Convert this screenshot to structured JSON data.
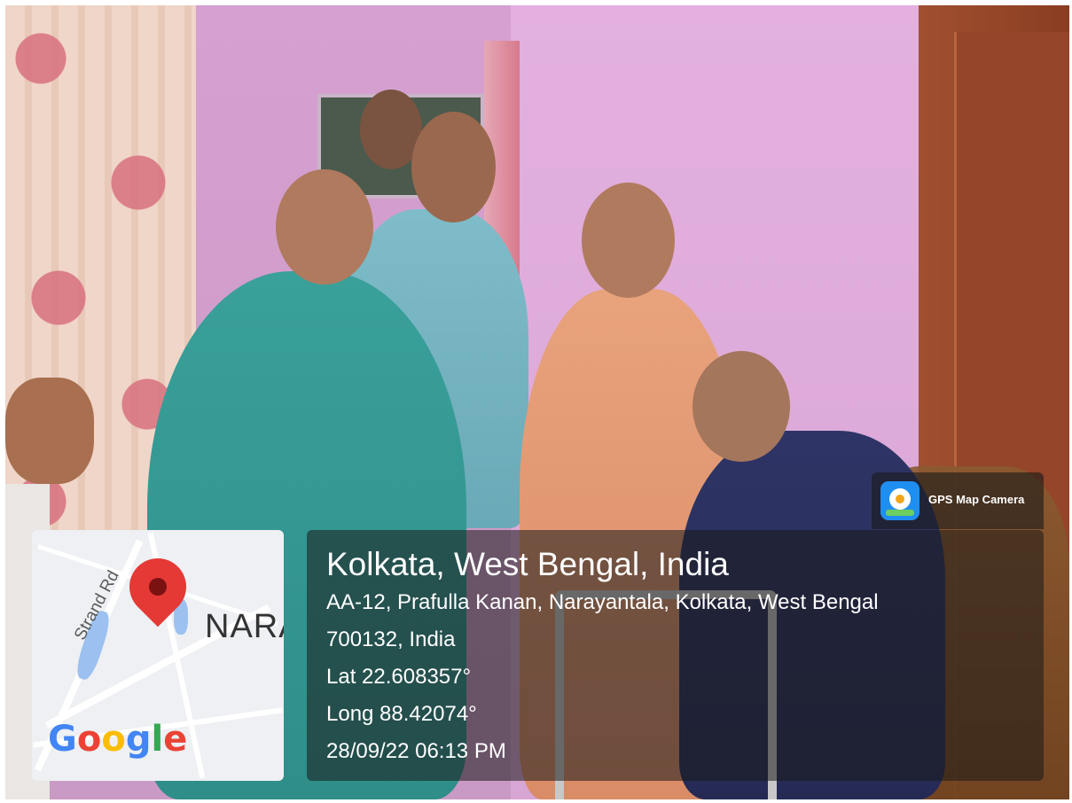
{
  "photo": {
    "description_icon": "photo-scene"
  },
  "map": {
    "area_label": "NARA",
    "street_label": "Strand Rd",
    "logo_text": "Google",
    "logo_letters": [
      "G",
      "o",
      "o",
      "g",
      "l",
      "e"
    ],
    "logo_colors": [
      "#4285F4",
      "#EA4335",
      "#FBBC05",
      "#4285F4",
      "#34A853",
      "#EA4335"
    ],
    "pin_icon": "map-pin-icon"
  },
  "location": {
    "title": "Kolkata, West Bengal, India",
    "address_line1": "AA-12, Prafulla Kanan, Narayantala, Kolkata, West Bengal",
    "address_line2": "700132, India",
    "latitude": "Lat 22.608357°",
    "longitude": "Long 88.42074°",
    "timestamp": "28/09/22 06:13 PM"
  },
  "badge": {
    "app_name": "GPS Map Camera",
    "icon": "gps-map-camera-icon"
  }
}
